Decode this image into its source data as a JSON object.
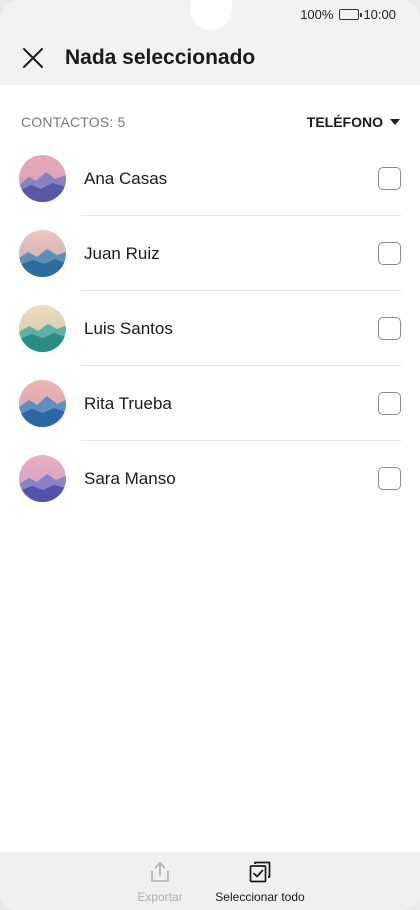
{
  "status_bar": {
    "battery_percent": "100%",
    "time": "10:00"
  },
  "header": {
    "title": "Nada seleccionado",
    "close_icon": "close-icon"
  },
  "list_header": {
    "count_label": "CONTACTOS: 5",
    "sort_label": "TELÉFONO"
  },
  "contacts": [
    {
      "name": "Ana Casas",
      "checked": false
    },
    {
      "name": "Juan Ruiz",
      "checked": false
    },
    {
      "name": "Luis Santos",
      "checked": false
    },
    {
      "name": "Rita Trueba",
      "checked": false
    },
    {
      "name": "Sara Manso",
      "checked": false
    }
  ],
  "bottom_bar": {
    "export_label": "Exportar",
    "select_all_label": "Seleccionar todo"
  },
  "colors": {
    "background": "#f2f2f2",
    "list_background": "#ffffff",
    "disabled_text": "#b0b0b0",
    "secondary_text": "#7a7a7a"
  }
}
